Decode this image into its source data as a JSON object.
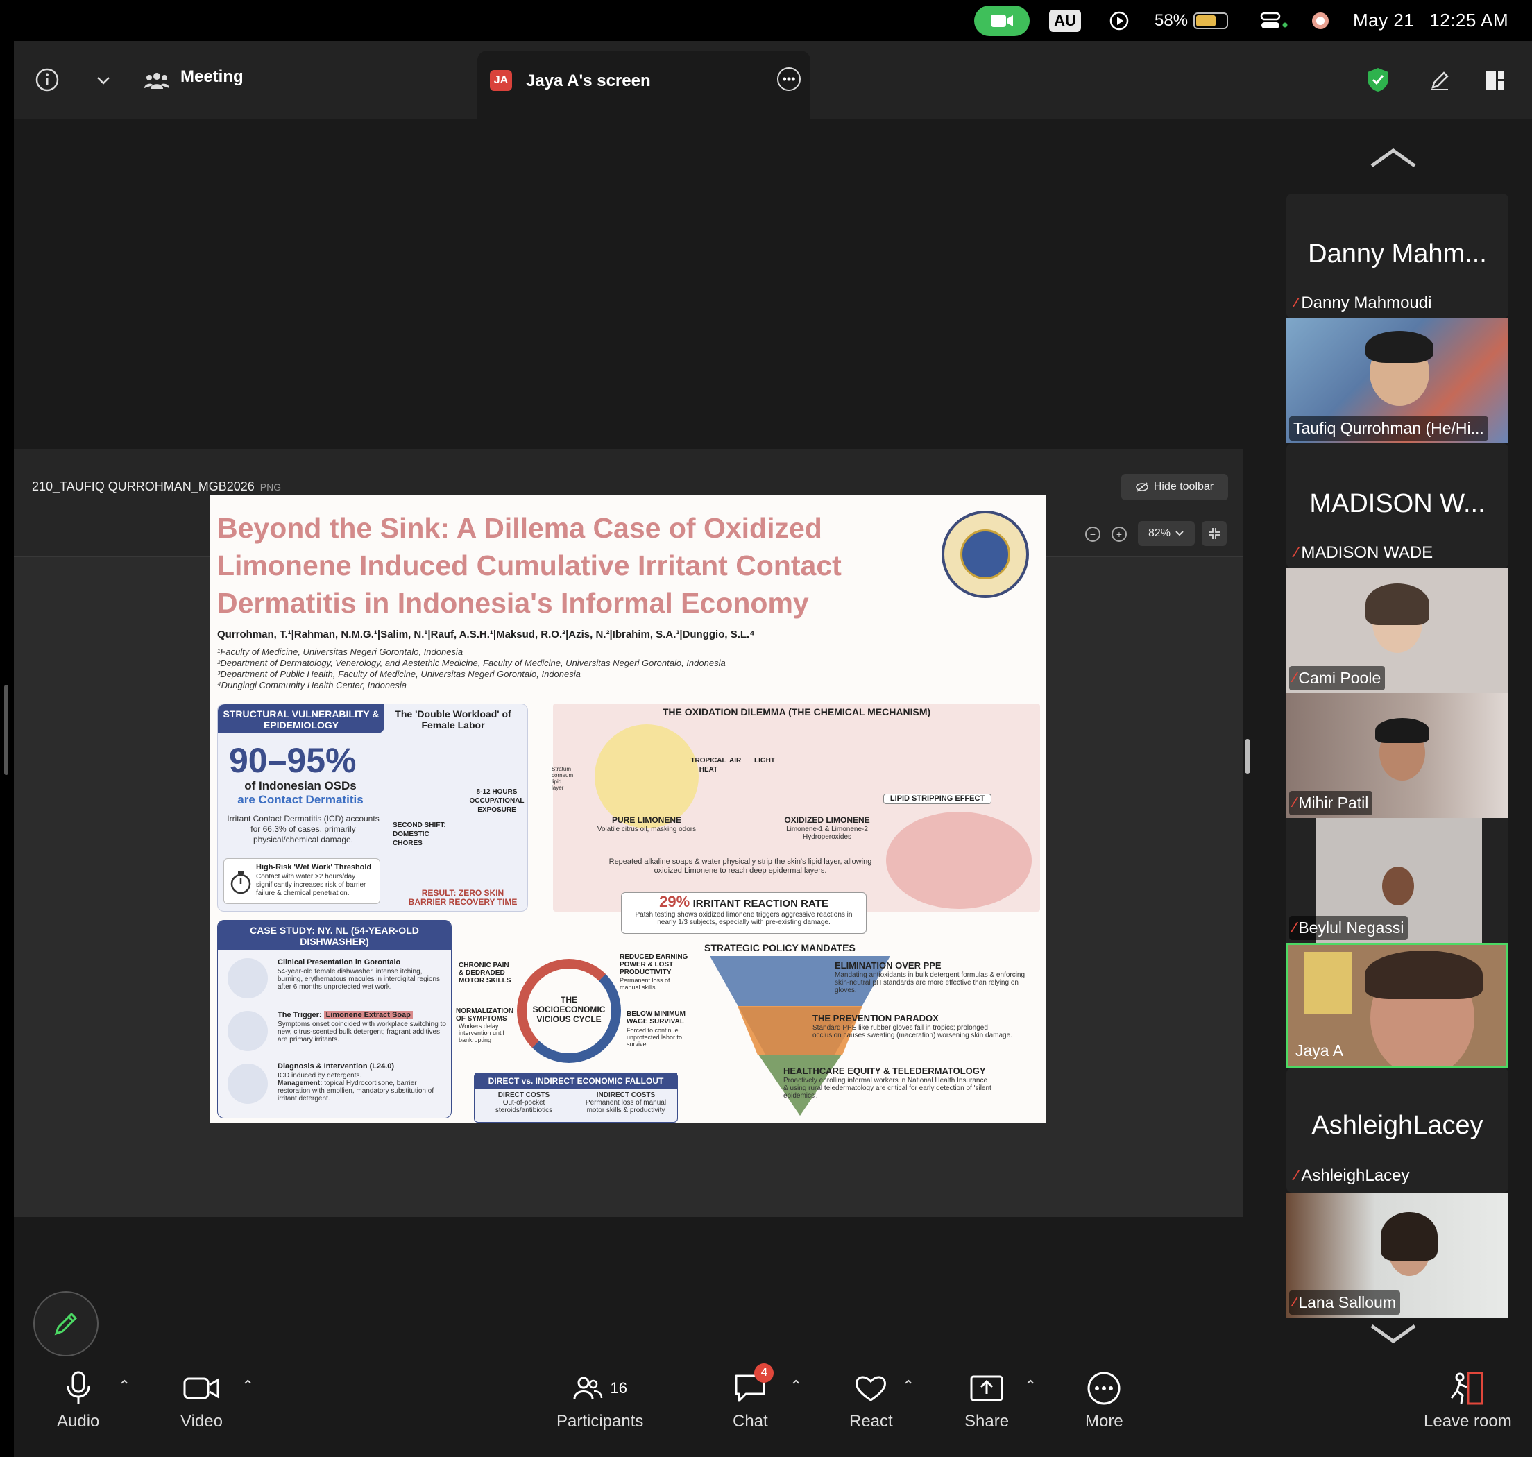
{
  "menubar": {
    "au": "AU",
    "battery": "58%",
    "date": "May 21",
    "time": "12:25 AM",
    "icons": [
      "video-camera-icon",
      "play-icon",
      "battery-icon",
      "control-center-icon",
      "sync-icon"
    ]
  },
  "topbar": {
    "meeting_label": "Meeting",
    "screen_tab_initials": "JA",
    "screen_tab_title": "Jaya A's screen",
    "icons": [
      "info-icon",
      "chevron-down-icon",
      "participants-icon",
      "more-icon",
      "shield-icon",
      "pencil-icon",
      "layout-icon"
    ]
  },
  "viewer": {
    "file_name": "210_TAUFIQ QURROHMAN_MGB2026",
    "file_ext": "PNG",
    "hide_toolbar": "Hide toolbar",
    "zoom_level": "82%"
  },
  "poster": {
    "title": "Beyond the Sink: A Dillema Case of Oxidized Limonene Induced Cumulative Irritant Contact Dermatitis in Indonesia's Informal Economy",
    "authors": "Qurrohman, T.¹|Rahman, N.M.G.¹|Salim, N.¹|Rauf, A.S.H.¹|Maksud, R.O.²|Azis, N.²|Ibrahim, S.A.³|Dunggio, S.L.⁴",
    "affiliations": [
      "¹Faculty of Medicine, Universitas Negeri Gorontalo, Indonesia",
      "²Department of Dermatology, Venerology, and Aestethic Medicine, Faculty of Medicine, Universitas Negeri Gorontalo, Indonesia",
      "³Department of Public Health, Faculty of Medicine, Universitas Negeri Gorontalo, Indonesia",
      "⁴Dungingi Community Health Center, Indonesia"
    ],
    "s1_head": "STRUCTURAL VULNERABILITY & EPIDEMIOLOGY",
    "s1_workload": "The 'Double Workload' of Female Labor",
    "s1_big": "90–95%",
    "s1_sub_a": "of Indonesian OSDs",
    "s1_sub_b": "are Contact Dermatitis",
    "s1_icd": "Irritant Contact Dermatitis (ICD) accounts for 66.3% of cases, primarily physical/chemical damage.",
    "s1_hours": "8-12 HOURS OCCUPATIONAL EXPOSURE",
    "s1_shift": "SECOND SHIFT: DOMESTIC CHORES",
    "s1_wet_title": "High-Risk 'Wet Work' Threshold",
    "s1_wet_text": "Contact with water >2 hours/day significantly increases risk of barrier failure & chemical penetration.",
    "s1_result": "RESULT: ZERO SKIN BARRIER RECOVERY TIME",
    "s2_head": "THE OXIDATION DILEMMA (THE CHEMICAL MECHANISM)",
    "s2_heat": "TROPICAL HEAT",
    "s2_air": "AIR",
    "s2_light": "LIGHT",
    "s2_pure": "PURE LIMONENE",
    "s2_pure_sub": "Volatile citrus oil, masking odors",
    "s2_ox": "OXIDIZED LIMONENE",
    "s2_ox_sub": "Limonene-1 & Limonene-2 Hydroperoxides",
    "s2_lipid": "LIPID STRIPPING EFFECT",
    "s2_layer": "Stratum corneum lipid layer",
    "s2_desc": "Repeated alkaline soaps & water physically strip the skin's lipid layer, allowing oxidized Limonene to reach deep epidermal layers.",
    "s2_rate": "29%",
    "s2_rate_lbl": "IRRITANT REACTION RATE",
    "s2_rate_sub": "Patsh testing shows oxidized limonene triggers aggressive reactions in nearly 1/3 subjects, especially with pre-existing damage.",
    "case_head": "CASE STUDY: NY. NL (54-YEAR-OLD DISHWASHER)",
    "case_1_t": "Clinical Presentation in Gorontalo",
    "case_1_d": "54-year-old female dishwasher, intense itching, burning, erythematous macules in interdigital regions after 6 months unprotected wet work.",
    "case_2_t": "The Trigger:",
    "case_2_tag": "Limonene Extract Soap",
    "case_2_d": "Symptoms onset coincided with workplace switching to new, citrus-scented bulk detergent; fragrant additives are primary irritants.",
    "case_3_t": "Diagnosis & Intervention (L24.0)",
    "case_3_d": "ICD induced by detergents.",
    "case_3_m_label": "Management:",
    "case_3_m": "topical Hydrocortisone, barrier restoration with emollien, mandatory substitution of irritant detergent.",
    "cycle_center": "THE SOCIOECONOMIC VICIOUS CYCLE",
    "cycle_1": "CHRONIC PAIN & DEDRADED MOTOR SKILLS",
    "cycle_2": "REDUCED EARNING POWER & LOST PRODUCTIVITY",
    "cycle_2_sub": "Permanent loss of manual skills",
    "cycle_3": "NORMALIZATION OF SYMPTOMS",
    "cycle_3_sub": "Workers delay intervention until bankrupting",
    "cycle_4": "BELOW MINIMUM WAGE SURVIVAL",
    "cycle_4_sub": "Forced to continue unprotected labor to survive",
    "fallout_head": "DIRECT vs. INDIRECT ECONOMIC FALLOUT",
    "fallout_direct": "DIRECT COSTS",
    "fallout_direct_sub": "Out-of-pocket steroids/antibiotics",
    "fallout_indirect": "INDIRECT COSTS",
    "fallout_indirect_sub": "Permanent loss of manual motor skills & productivity",
    "policy_head": "STRATEGIC POLICY MANDATES",
    "pol_1": "ELIMINATION OVER PPE",
    "pol_1_d": "Mandating antioxidants in bulk detergent formulas & enforcing skin-neutral pH standards are more effective than relying on gloves.",
    "pol_2": "THE PREVENTION PARADOX",
    "pol_2_d": "Standard PPE like rubber gloves fail in tropics; prolonged occlusion causes sweating (maceration) worsening skin damage.",
    "pol_3": "HEALTHCARE EQUITY & TELEDERMATOLOGY",
    "pol_3_d": "Proactively enrolling informal workers in National Health Insurance & using rural teledermatology are critical for early detection of 'silent epidemics'."
  },
  "participants_panel": {
    "tiles": [
      {
        "big_name": "Danny Mahm...",
        "name": "Danny Mahmoudi"
      },
      {
        "video_name": "Taufiq Qurrohman (He/Hi..."
      },
      {
        "big_name": "MADISON W...",
        "name": "MADISON WADE"
      },
      {
        "video_name": "Cami Poole"
      },
      {
        "video_name": "Mihir Patil"
      },
      {
        "video_name": "Beylul Negassi"
      },
      {
        "video_name": "Jaya A"
      },
      {
        "big_name": "AshleighLacey",
        "name": "AshleighLacey"
      },
      {
        "video_name": "Lana Salloum"
      }
    ]
  },
  "controls": {
    "audio": "Audio",
    "video": "Video",
    "participants": "Participants",
    "participants_count": "16",
    "chat": "Chat",
    "chat_badge": "4",
    "react": "React",
    "share": "Share",
    "more": "More",
    "leave": "Leave room"
  },
  "colors": {
    "accent_green": "#3fbf5a",
    "active_speaker": "#4cd964",
    "mute_red": "#e0473b",
    "poster_title": "#d38a8a",
    "poster_navy": "#3b4d8b"
  }
}
